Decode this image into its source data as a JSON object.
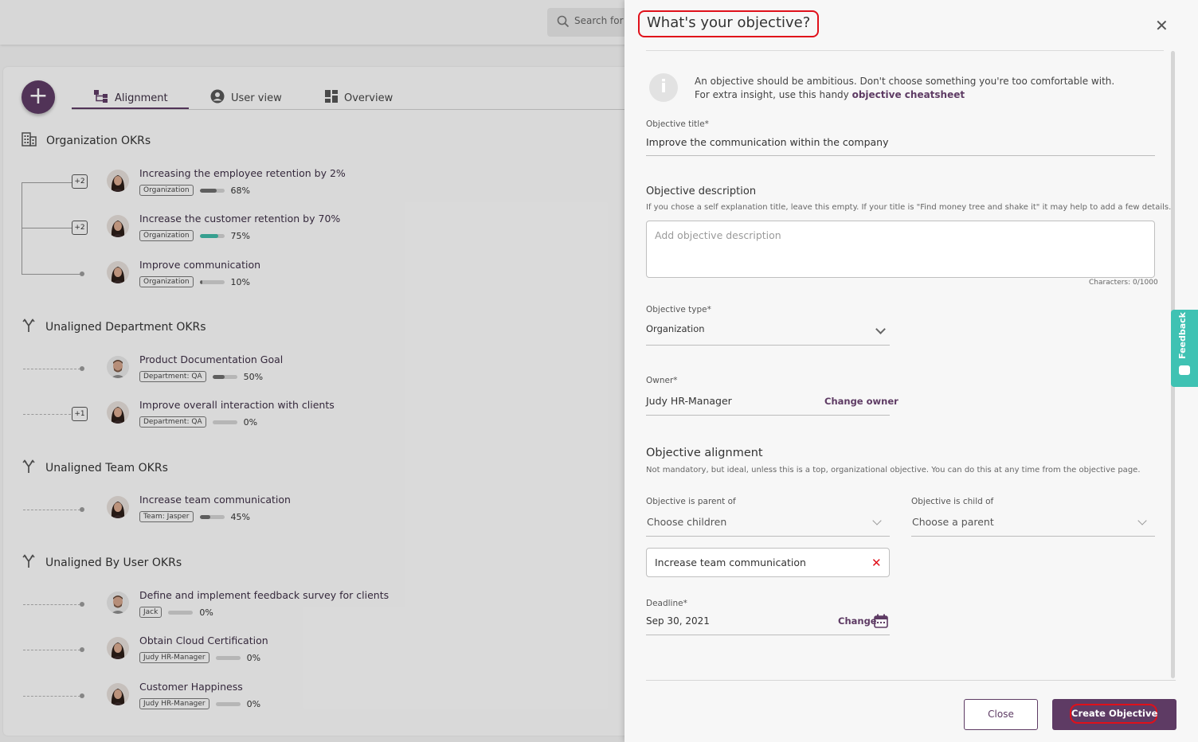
{
  "search": {
    "placeholder": "Search for o"
  },
  "tabs": [
    {
      "label": "Alignment",
      "icon": "hierarchy-icon"
    },
    {
      "label": "User view",
      "icon": "user-circle-icon"
    },
    {
      "label": "Overview",
      "icon": "dashboard-icon"
    }
  ],
  "sections": {
    "org": {
      "title": "Organization OKRs",
      "icon": "building-icon"
    },
    "dept": {
      "title": "Unaligned Department OKRs",
      "icon": "fork-icon"
    },
    "team": {
      "title": "Unaligned Team OKRs",
      "icon": "fork-icon"
    },
    "user": {
      "title": "Unaligned By User OKRs",
      "icon": "fork-icon"
    }
  },
  "okrs": [
    {
      "title": "Increasing the employee retention by 2%",
      "tag": "Organization",
      "progress": 0.68,
      "percent": "68%",
      "badge": "+2",
      "avatar": "female"
    },
    {
      "title": "Increase the customer retention by 70%",
      "tag": "Organization",
      "progress": 0.75,
      "percent": "75%",
      "badge": "+2",
      "avatar": "female",
      "bar_color": "#3fb8a6"
    },
    {
      "title": "Improve communication",
      "tag": "Organization",
      "progress": 0.1,
      "percent": "10%",
      "avatar": "female"
    },
    {
      "title": "Product Documentation Goal",
      "tag": "Department: QA",
      "progress": 0.5,
      "percent": "50%",
      "avatar": "male"
    },
    {
      "title": "Improve overall interaction with clients",
      "tag": "Department: QA",
      "progress": 0.0,
      "percent": "0%",
      "badge": "+1",
      "avatar": "female"
    },
    {
      "title": "Increase team communication",
      "tag": "Team: Jasper",
      "progress": 0.45,
      "percent": "45%",
      "avatar": "female"
    },
    {
      "title": "Define and implement feedback survey for clients",
      "tag": "Jack",
      "progress": 0.0,
      "percent": "0%",
      "avatar": "male"
    },
    {
      "title": "Obtain Cloud Certification",
      "tag": "Judy HR-Manager",
      "progress": 0.0,
      "percent": "0%",
      "avatar": "female"
    },
    {
      "title": "Customer Happiness",
      "tag": "Judy HR-Manager",
      "progress": 0.0,
      "percent": "0%",
      "avatar": "female"
    }
  ],
  "panel": {
    "title": "What's your objective?",
    "info_line1": "An objective should be ambitious. Don't choose something you're too comfortable with.",
    "info_line2": "For extra insight, use this handy ",
    "info_link": "objective cheatsheet",
    "objective_title_label": "Objective title*",
    "objective_title_value": "Improve the communication within the company",
    "description_heading": "Objective description",
    "description_hint": "If you chose a self explanation title, leave this empty. If your title is \"Find money tree and shake it\" it may help to add a few details.",
    "description_placeholder": "Add objective description",
    "char_count": "Characters: 0/1000",
    "type_label": "Objective type*",
    "type_value": "Organization",
    "owner_label": "Owner*",
    "owner_value": "Judy HR-Manager",
    "change_owner": "Change owner",
    "alignment_heading": "Objective alignment",
    "alignment_hint": "Not mandatory, but ideal, unless this is a top, organizational objective. You can do this at any time from the objective page.",
    "parent_of_label": "Objective is parent of",
    "parent_of_placeholder": "Choose children",
    "child_of_label": "Objective is child of",
    "child_of_placeholder": "Choose a parent",
    "chip_value": "Increase team communication",
    "deadline_label": "Deadline*",
    "deadline_value": "Sep 30, 2021",
    "deadline_change": "Change",
    "close_button": "Close",
    "create_button": "Create Objective"
  },
  "feedback_tab": "Feedback",
  "colors": {
    "accent": "#5e3b64",
    "highlight": "#e0101a",
    "feedback": "#3fc2b3",
    "progress_teal": "#3fb8a6"
  }
}
